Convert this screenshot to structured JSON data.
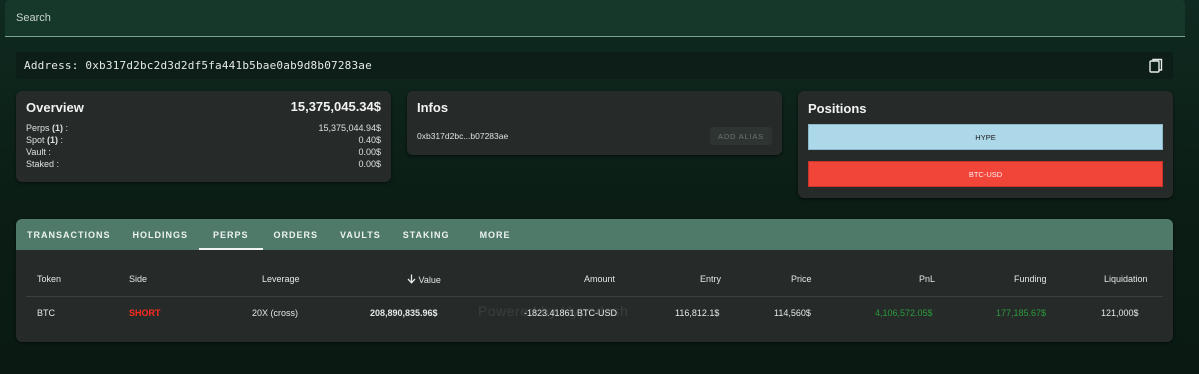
{
  "search": {
    "placeholder": "Search"
  },
  "address": {
    "text": "Address: 0xb317d2bc2d3d2df5fa441b5bae0ab9d8b07283ae"
  },
  "overview": {
    "title": "Overview",
    "total": "15,375,045.34$",
    "rows": [
      {
        "label": "Perps",
        "count": "(1)",
        "value": "15,375,044.94$"
      },
      {
        "label": "Spot",
        "count": "(1)",
        "value": "0.40$"
      },
      {
        "label": "Vault :",
        "count": "",
        "value": "0.00$"
      },
      {
        "label": "Staked :",
        "count": "",
        "value": "0.00$"
      }
    ]
  },
  "infos": {
    "title": "Infos",
    "short_address": "0xb317d2bc...b07283ae",
    "add_alias_label": "ADD ALIAS"
  },
  "positions": {
    "title": "Positions",
    "items": [
      {
        "label": "HYPE",
        "color": "#acd8e9"
      },
      {
        "label": "BTC-USD",
        "color": "#f2453a"
      }
    ]
  },
  "tabs": [
    "TRANSACTIONS",
    "HOLDINGS",
    "PERPS",
    "ORDERS",
    "VAULTS",
    "STAKING",
    "MORE"
  ],
  "active_tab": "PERPS",
  "table": {
    "headers": [
      "Token",
      "Side",
      "Leverage",
      "Value",
      "Amount",
      "Entry",
      "Price",
      "PnL",
      "Funding",
      "Liquidation"
    ],
    "sort_icon": "arrow-down-icon",
    "rows": [
      {
        "token": "BTC",
        "side": "SHORT",
        "leverage": "20X (cross)",
        "value": "208,890,835.96$",
        "amount": "-1823.41861 BTC-USD",
        "entry": "116,812.1$",
        "price": "114,560$",
        "pnl": "4,106,572.05$",
        "funding": "177,185.67$",
        "liquidation": "121,000$"
      }
    ]
  },
  "watermark": "Powered by Hypedash",
  "colors": {
    "accent_tab": "#4f7a6a",
    "short": "#ff2a1f",
    "positive": "#2b9a3c",
    "hype": "#acd8e9",
    "btc": "#f2453a"
  }
}
